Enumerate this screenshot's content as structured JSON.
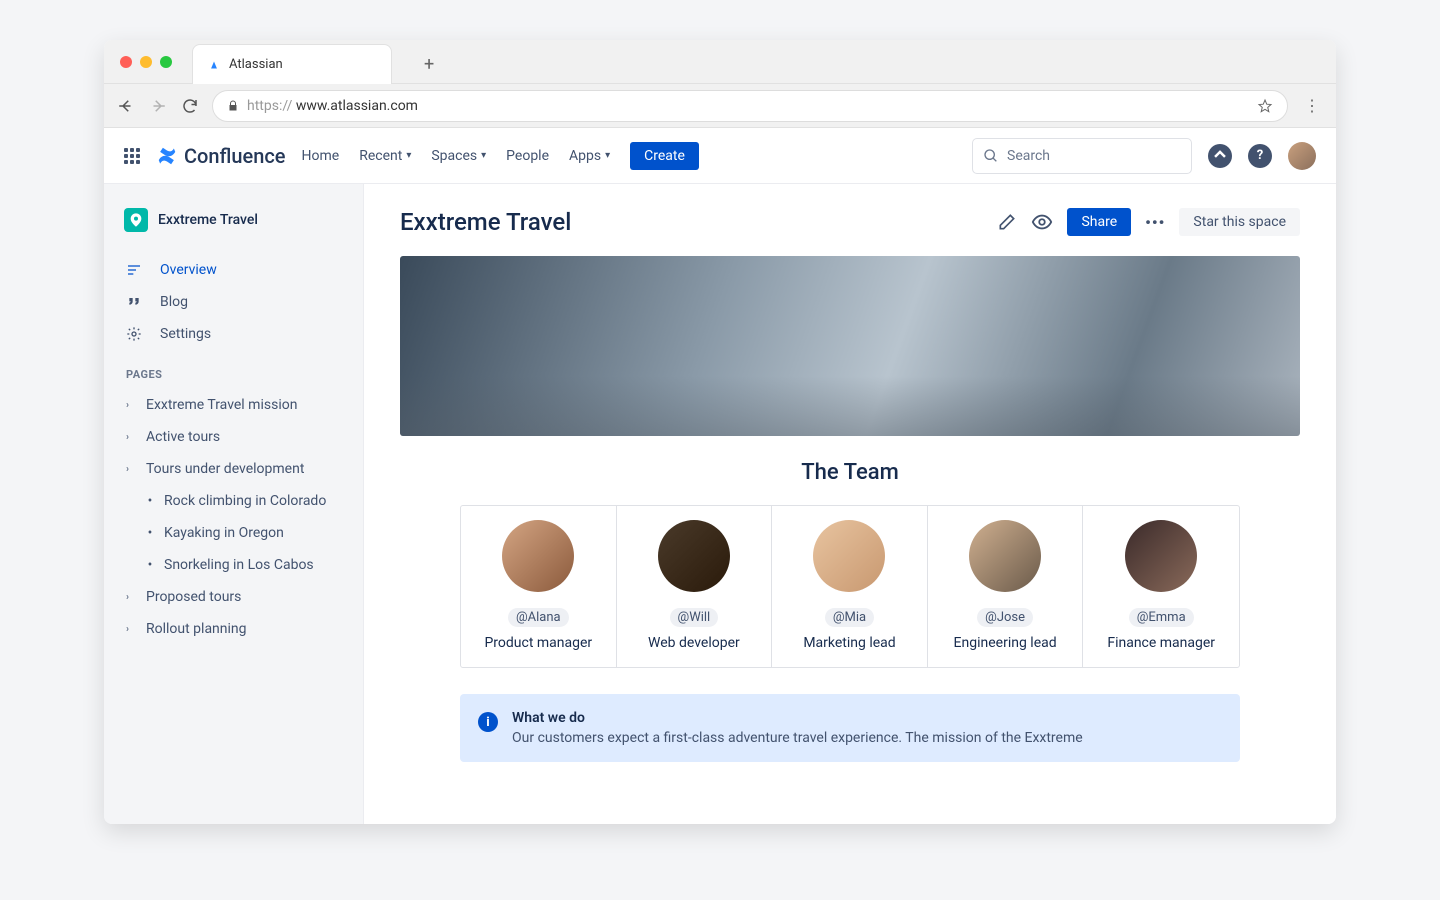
{
  "browser": {
    "tab_title": "Atlassian",
    "url_prefix": "https://",
    "url_domain": "www.atlassian.com"
  },
  "brand": "Confluence",
  "nav": {
    "home": "Home",
    "recent": "Recent",
    "spaces": "Spaces",
    "people": "People",
    "apps": "Apps",
    "create": "Create"
  },
  "search_placeholder": "Search",
  "sidebar": {
    "space_name": "Exxtreme Travel",
    "overview": "Overview",
    "blog": "Blog",
    "settings": "Settings",
    "pages_label": "PAGES",
    "pages": [
      {
        "label": "Exxtreme Travel mission"
      },
      {
        "label": "Active tours"
      },
      {
        "label": "Tours under development"
      },
      {
        "label": "Proposed tours"
      },
      {
        "label": "Rollout planning"
      }
    ],
    "subpages": [
      {
        "label": "Rock climbing in Colorado"
      },
      {
        "label": "Kayaking in Oregon"
      },
      {
        "label": "Snorkeling in Los Cabos"
      }
    ]
  },
  "page": {
    "title": "Exxtreme Travel",
    "share": "Share",
    "star": "Star this space",
    "team_heading": "The Team",
    "team": [
      {
        "handle": "@Alana",
        "role": "Product manager"
      },
      {
        "handle": "@Will",
        "role": "Web developer"
      },
      {
        "handle": "@Mia",
        "role": "Marketing lead"
      },
      {
        "handle": "@Jose",
        "role": "Engineering lead"
      },
      {
        "handle": "@Emma",
        "role": "Finance manager"
      }
    ],
    "info_title": "What we do",
    "info_body": "Our customers expect a first-class adventure travel experience. The mission of the Exxtreme"
  }
}
